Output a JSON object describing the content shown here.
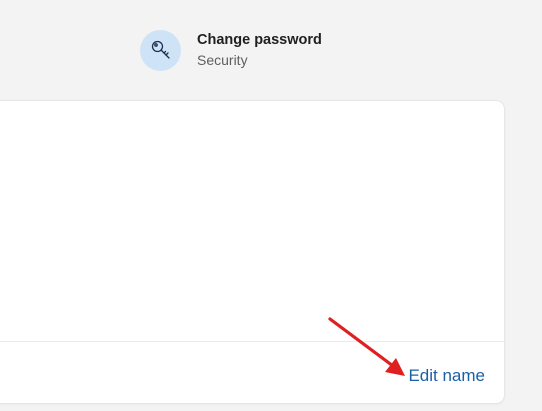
{
  "quick_link": {
    "title": "Change password",
    "subtitle": "Security",
    "icon": "key-icon",
    "icon_bg_color": "#cfe3f6",
    "icon_color": "#1f2f4f"
  },
  "card": {
    "footer": {
      "edit_name_label": "Edit name",
      "link_color": "#1b5fa5"
    }
  },
  "annotation": {
    "arrow_color": "#e02020"
  }
}
